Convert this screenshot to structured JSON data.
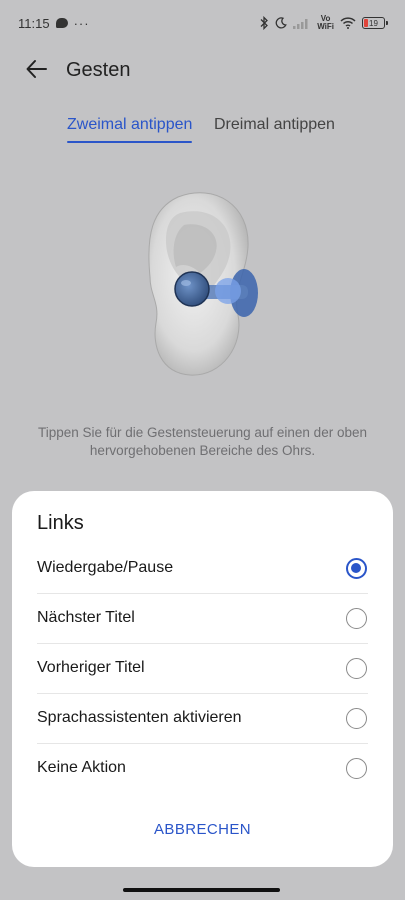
{
  "status_bar": {
    "time": "11:15",
    "more": "···",
    "vowifi_top": "Vo",
    "vowifi_bottom": "WiFi",
    "battery_level": "19"
  },
  "header": {
    "title": "Gesten"
  },
  "tabs": [
    {
      "label": "Zweimal antippen",
      "active": true
    },
    {
      "label": "Dreimal antippen",
      "active": false
    }
  ],
  "hint": "Tippen Sie für die Gestensteuerung auf einen der oben hervorgehobenen Bereiche des Ohrs.",
  "sheet": {
    "title": "Links",
    "options": [
      {
        "label": "Wiedergabe/Pause",
        "selected": true
      },
      {
        "label": "Nächster Titel",
        "selected": false
      },
      {
        "label": "Vorheriger Titel",
        "selected": false
      },
      {
        "label": "Sprachassistenten aktivieren",
        "selected": false
      },
      {
        "label": "Keine Aktion",
        "selected": false
      }
    ],
    "cancel_label": "ABBRECHEN"
  },
  "colors": {
    "accent": "#2a55c9",
    "scrim_background": "#c3c3c5",
    "sheet_background": "#ffffff"
  },
  "icons": {
    "back": "arrow-left-icon",
    "chat": "chat-bubble-icon",
    "bluetooth": "bluetooth-icon",
    "moon": "moon-icon",
    "signal": "signal-icon",
    "wifi": "wifi-icon",
    "battery": "battery-icon"
  }
}
